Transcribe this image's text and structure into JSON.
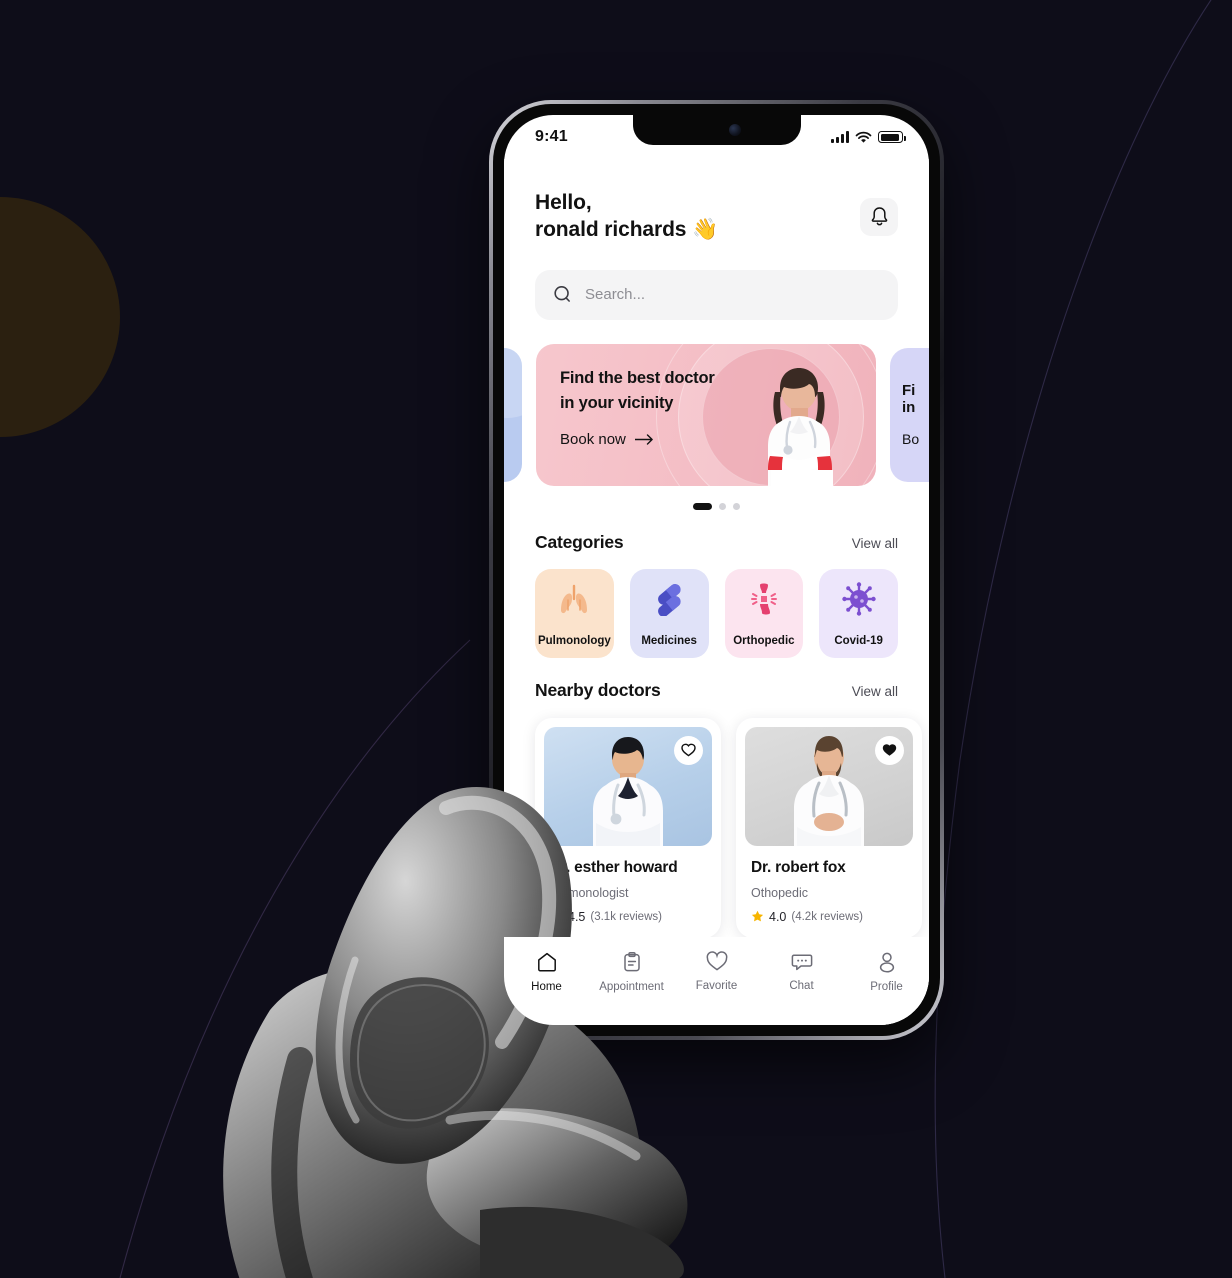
{
  "background": {
    "page_color": "#0e0d19",
    "accent_circle_color": "#2b2010"
  },
  "device": {
    "status_bar": {
      "time": "9:41",
      "signal_icon": "cellular-bars-icon",
      "wifi_icon": "wifi-icon",
      "battery_icon": "battery-icon"
    }
  },
  "app": {
    "header": {
      "greeting_line1": "Hello,",
      "greeting_line2": "ronald richards 👋",
      "notification_icon": "bell-icon"
    },
    "search": {
      "placeholder": "Search...",
      "icon": "search-icon"
    },
    "banners": {
      "prev_partial": {
        "color": "#b9cbf0"
      },
      "active": {
        "title_line1": "Find the best doctor",
        "title_line2": "in your vicinity",
        "cta": "Book now",
        "cta_icon": "arrow-right-icon",
        "color": "#f4bcc4"
      },
      "next_partial": {
        "title_line1": "Fi",
        "title_line2": "in",
        "cta": "Bo",
        "color": "#d6d6f7"
      },
      "pager": {
        "total": 3,
        "active_index": 0
      }
    },
    "categories_section": {
      "title": "Categories",
      "view_all": "View all",
      "items": [
        {
          "label": "Pulmonology",
          "icon": "lungs-icon",
          "bg": "#fbe3cc",
          "fg": "#efa26a"
        },
        {
          "label": "Medicines",
          "icon": "capsules-icon",
          "bg": "#e0e2f8",
          "fg": "#4a4ec4"
        },
        {
          "label": "Orthopedic",
          "icon": "joint-pain-icon",
          "bg": "#fce4ef",
          "fg": "#e5406f"
        },
        {
          "label": "Covid-19",
          "icon": "virus-icon",
          "bg": "#ede6fb",
          "fg": "#7c4fd0"
        }
      ]
    },
    "doctors_section": {
      "title": "Nearby doctors",
      "view_all": "View all",
      "items": [
        {
          "name": "Dr. esther howard",
          "name_visible": "ward",
          "specialty": "Pulmonologist",
          "rating": "4.5",
          "reviews": "(3.1k reviews)",
          "reviews_visible": "ews)",
          "favorite": false,
          "favorite_icon": "heart-outline-icon"
        },
        {
          "name": "Dr. robert fox",
          "specialty": "Othopedic",
          "rating": "4.0",
          "reviews": "(4.2k reviews)",
          "favorite": true,
          "favorite_icon": "heart-filled-icon",
          "star_icon": "star-icon"
        }
      ]
    },
    "tabbar": {
      "items": [
        {
          "label": "Home",
          "icon": "home-icon",
          "active": true
        },
        {
          "label": "Appointment",
          "icon": "clipboard-icon",
          "active": false
        },
        {
          "label": "Favorite",
          "icon": "heart-icon",
          "active": false
        },
        {
          "label": "Chat",
          "icon": "chat-bubble-icon",
          "active": false
        },
        {
          "label": "Profile",
          "icon": "person-icon",
          "active": false
        }
      ]
    }
  }
}
